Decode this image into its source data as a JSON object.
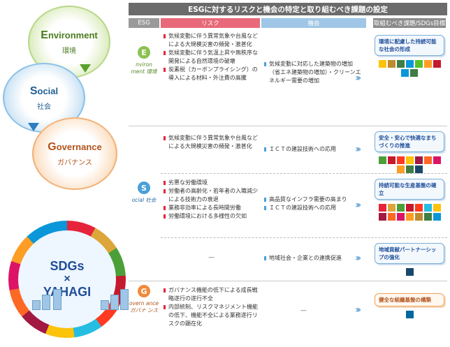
{
  "left": {
    "environment": {
      "initial": "E",
      "rest": "nvironment",
      "jp": "環境"
    },
    "social": {
      "initial": "S",
      "rest": "ocial",
      "jp": "社会"
    },
    "governance": {
      "initial": "G",
      "rest": "overnance",
      "jp": "ガバナンス"
    },
    "badge": {
      "line1": "SDGs",
      "line2": "×",
      "line3": "YAHAGI"
    }
  },
  "title": "ESGに対するリスクと機会の特定と取り組むべき課題の設定",
  "headers": {
    "esg": "ESG",
    "risk": "リスク",
    "opportunity": "機会",
    "goal": "取組むべき課題/SDGs目標"
  },
  "rows": {
    "environment": {
      "letter": "E",
      "word": "nviron ment 環境",
      "risks": [
        "気候変動に伴う異常気象や台風などによる大規模災害の頻発・激甚化",
        "気候変動に伴う気温上昇や無秩序な開発による自然環境の破壊",
        "炭素税（カーボンプライシング）の導入による材料・外注費の高騰"
      ],
      "opportunities": [
        "気候変動に対応した建築物の増加（省エネ建築物の増加）・クリーンエネルギー需要の増加"
      ],
      "goal": "環境に配慮した持続可能な社会の形成"
    },
    "social_1": {
      "risks": [
        "気候変動に伴う異常気象や台風などによる大規模災害の頻発・激甚化"
      ],
      "opportunities": [
        "ＩＣＴの建設技術への応用"
      ],
      "goal": "安全・安心で快適なまちづくりの推進"
    },
    "social_2": {
      "letter": "S",
      "word": "ocial 社会",
      "risks": [
        "劣悪な労働環境",
        "労働者の高齢化・若年者の入職減少による技術力の衰退",
        "業務非効率による長時間労働",
        "労働環境における多様性の欠如"
      ],
      "opportunities": [
        "高品質なインフラ需要の高まり",
        "ＩＣＴの建設技術への応用"
      ],
      "goal": "持続可能な生産基盤の確立"
    },
    "social_3": {
      "risk_dash": "—",
      "opportunities": [
        "地域社会・企業との連携促進"
      ],
      "goal": "地域貢献パートナーシップの強化"
    },
    "governance": {
      "letter": "G",
      "word": "overn ance ガバナ ンス",
      "risks": [
        "ガバナンス機能の低下による成長戦略遂行の遂行不全",
        "内部統制、リスクマネジメント機能の低下、機能不全による業務遂行リスクの顕在化"
      ],
      "opp_dash": "—",
      "goal": "健全な組織基盤の構築"
    }
  },
  "colors": {
    "environment": "#8cc152",
    "social": "#4a9fd9",
    "governance": "#f08a3c",
    "risk": "#e5243b",
    "opportunity": "#4a9fd9"
  },
  "sdg_tiles": {
    "environment": [
      "#fcc30b",
      "#bf8b2e",
      "#3f7e44",
      "#0a97d9",
      "#56c02b",
      "#fd9d24",
      "#c5192d",
      "#0a97d9",
      "#3f7e44"
    ],
    "social_1": [
      "#4c9f38",
      "#c5192d",
      "#ff3a21",
      "#fcc30b",
      "#a21942",
      "#fd6925",
      "#dd1367",
      "#fd9d24",
      "#3f7e44",
      "#19486a"
    ],
    "social_2": [
      "#e5243b",
      "#dda63a",
      "#4c9f38",
      "#c5192d",
      "#ff3a21",
      "#26bde2",
      "#fcc30b",
      "#a21942",
      "#fd6925",
      "#dd1367",
      "#fd9d24",
      "#bf8b2e",
      "#3f7e44",
      "#0a97d9"
    ],
    "social_3": [
      "#19486a"
    ],
    "governance": [
      "#00689d"
    ]
  }
}
